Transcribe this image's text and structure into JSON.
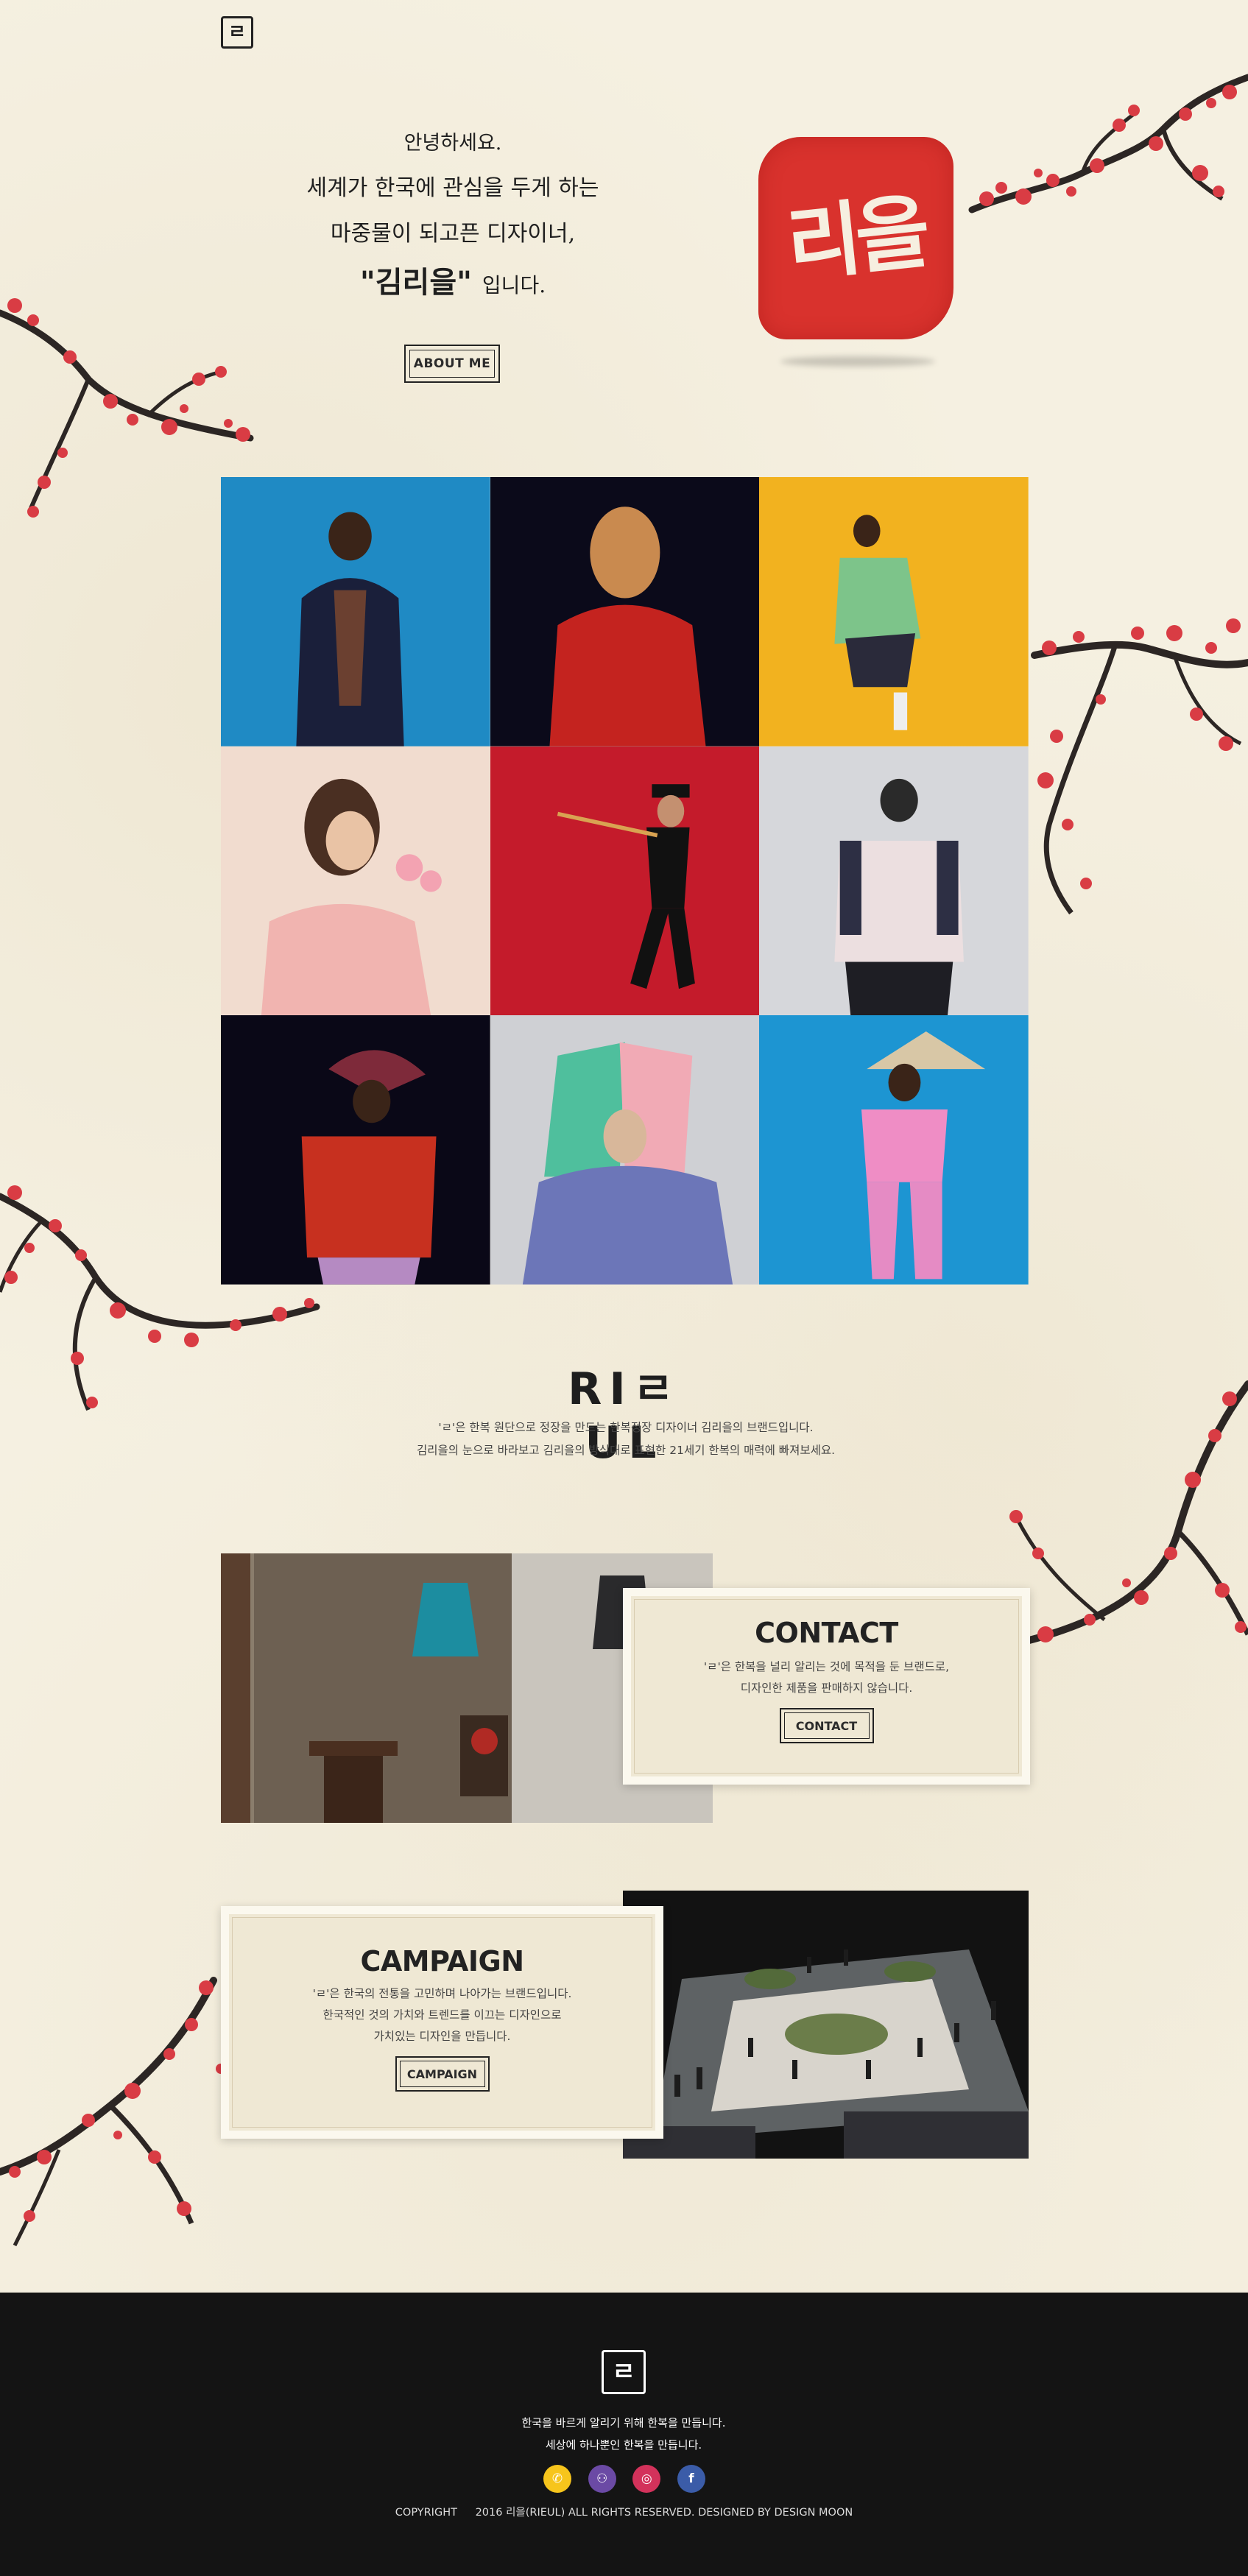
{
  "header": {
    "logo_glyph": "ㄹ"
  },
  "greeting": {
    "line1": "안녕하세요.",
    "line2": "세계가 한국에 관심을 두게 하는",
    "line3": "마중물이 되고픈 디자이너,",
    "line4_name": "\"김리을\"",
    "line4_suffix": "입니다.",
    "about_label": "ABOUT ME"
  },
  "seal": {
    "text": "리을",
    "color": "#d9322d"
  },
  "gallery": {
    "tiles": [
      {
        "bg": "#1f8ac4"
      },
      {
        "bg": "#0b0a1a"
      },
      {
        "bg": "#f2b21f"
      },
      {
        "bg": "#f1dccf"
      },
      {
        "bg": "#c41b2b"
      },
      {
        "bg": "#d6d7db"
      },
      {
        "bg": "#0a0817"
      },
      {
        "bg": "#cfd0d4"
      },
      {
        "bg": "#1d95d2"
      }
    ]
  },
  "brand": {
    "logo": "RIㄹUL",
    "desc_line1": "'ㄹ'은 한복 원단으로 정장을 만드는 한복정장 디자이너 김리을의 브랜드입니다.",
    "desc_line2": "김리을의 눈으로 바라보고 김리을의 방식대로 표현한 21세기 한복의 매력에 빠져보세요."
  },
  "contact": {
    "title": "CONTACT",
    "line1": "'ㄹ'은 한복을 널리 알리는 것에 목적을 둔 브랜드로,",
    "line2": "디자인한 제품을 판매하지 않습니다.",
    "button": "CONTACT"
  },
  "campaign": {
    "title": "CAMPAIGN",
    "line1": "'ㄹ'은 한국의 전통을 고민하며 나아가는 브랜드입니다.",
    "line2": "한국적인 것의 가치와 트렌드를 이끄는 디자인으로",
    "line3": "가치있는 디자인을 만듭니다.",
    "button": "CAMPAIGN"
  },
  "footer": {
    "logo_glyph": "ㄹ",
    "line1": "한국을 바르게 알리기 위해 한복을 만듭니다.",
    "line2": "세상에 하나뿐인 한복을 만듭니다.",
    "socials": [
      {
        "name": "kakaotalk",
        "glyph": "✆",
        "color": "#f7c51c"
      },
      {
        "name": "community",
        "glyph": "⚇",
        "color": "#6b4aa5"
      },
      {
        "name": "instagram",
        "glyph": "◎",
        "color": "#d3325b"
      },
      {
        "name": "facebook",
        "glyph": "f",
        "color": "#3b5ca8"
      }
    ],
    "copyright_label": "COPYRIGHT",
    "copyright_text": "2016 리을(RIEUL) ALL RIGHTS RESERVED. DESIGNED BY DESIGN MOON"
  }
}
